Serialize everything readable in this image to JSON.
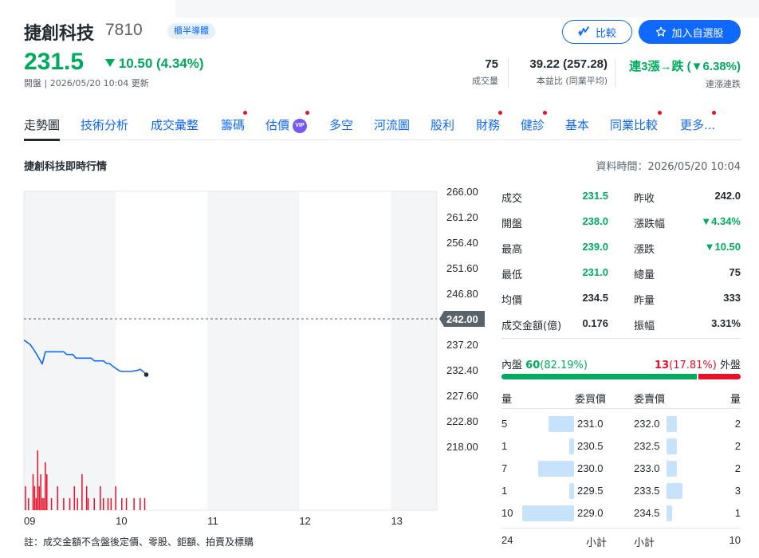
{
  "header": {
    "stock_name": "捷創科技",
    "stock_code": "7810",
    "market_badge": "櫃半導體",
    "compare_label": "比較",
    "watchlist_label": "加入自選股",
    "price": "231.5",
    "change": "10.50 (4.34%)",
    "updated": "開盤 | 2026/05/20 10:04 更新",
    "stats": [
      {
        "value": "75",
        "label": "成交量"
      },
      {
        "value": "39.22 (257.28)",
        "label": "本益比 (同業平均)"
      },
      {
        "value": "連3漲→跌 (▼6.38%)",
        "label": "連漲連跌"
      }
    ],
    "icons": {
      "compare": "compare-arrows-icon",
      "watch": "star-icon",
      "down": "triangle-down-icon"
    },
    "colors": {
      "down": "#00ab5e",
      "up": "#eb0f29",
      "brand": "#0f69ff"
    }
  },
  "tabs": [
    {
      "label": "走勢圖",
      "active": true,
      "dot": false
    },
    {
      "label": "技術分析",
      "active": false,
      "dot": false
    },
    {
      "label": "成交彙整",
      "active": false,
      "dot": false
    },
    {
      "label": "籌碼",
      "active": false,
      "dot": true
    },
    {
      "label": "估價",
      "active": false,
      "dot": true,
      "vip": "VIP"
    },
    {
      "label": "多空",
      "active": false,
      "dot": false
    },
    {
      "label": "河流圖",
      "active": false,
      "dot": false
    },
    {
      "label": "股利",
      "active": false,
      "dot": false
    },
    {
      "label": "財務",
      "active": false,
      "dot": true
    },
    {
      "label": "健診",
      "active": false,
      "dot": true
    },
    {
      "label": "基本",
      "active": false,
      "dot": false
    },
    {
      "label": "同業比較",
      "active": false,
      "dot": true
    },
    {
      "label": "更多...",
      "active": false,
      "dot": true
    }
  ],
  "section": {
    "title": "捷創科技即時行情",
    "data_time": "資料時間：2026/05/20 10:04"
  },
  "chart_data": {
    "type": "line",
    "x_ticks": [
      "09",
      "10",
      "11",
      "12",
      "13"
    ],
    "y_ticks": [
      "266.00",
      "261.20",
      "256.40",
      "251.60",
      "246.80",
      "237.20",
      "232.40",
      "227.60",
      "222.80",
      "218.00"
    ],
    "ylim": [
      218.0,
      266.0
    ],
    "reference_label": "242.00",
    "reference_value": 242.0,
    "x_range_minutes": [
      0,
      270
    ],
    "price_series": [
      [
        0,
        238.0
      ],
      [
        2,
        237.6
      ],
      [
        4,
        237.2
      ],
      [
        6,
        236.4
      ],
      [
        8,
        235.5
      ],
      [
        10,
        234.5
      ],
      [
        12,
        233.5
      ],
      [
        14,
        235.8
      ],
      [
        16,
        235.8
      ],
      [
        22,
        235.8
      ],
      [
        26,
        235.8
      ],
      [
        28,
        235.3
      ],
      [
        32,
        235.3
      ],
      [
        34,
        234.6
      ],
      [
        36,
        234.6
      ],
      [
        40,
        234.6
      ],
      [
        44,
        234.6
      ],
      [
        46,
        234.1
      ],
      [
        52,
        234.1
      ],
      [
        54,
        233.6
      ],
      [
        56,
        233.6
      ],
      [
        58,
        233.1
      ],
      [
        60,
        232.7
      ],
      [
        62,
        232.3
      ],
      [
        64,
        232.1
      ],
      [
        70,
        232.1
      ],
      [
        74,
        232.3
      ],
      [
        76,
        232.5
      ],
      [
        78,
        232.1
      ],
      [
        80,
        231.5
      ]
    ],
    "last_point": [
      80,
      231.5
    ],
    "volume_series": [
      [
        1,
        2
      ],
      [
        3,
        1
      ],
      [
        6,
        3
      ],
      [
        7,
        2
      ],
      [
        8,
        1
      ],
      [
        9,
        5
      ],
      [
        10,
        2
      ],
      [
        11,
        3
      ],
      [
        12,
        1
      ],
      [
        13,
        1
      ],
      [
        14,
        4
      ],
      [
        15,
        3
      ],
      [
        18,
        1
      ],
      [
        22,
        2
      ],
      [
        26,
        1
      ],
      [
        30,
        1
      ],
      [
        33,
        2
      ],
      [
        35,
        1
      ],
      [
        38,
        3
      ],
      [
        41,
        2
      ],
      [
        42,
        1
      ],
      [
        46,
        1
      ],
      [
        50,
        2
      ],
      [
        52,
        1
      ],
      [
        55,
        1
      ],
      [
        57,
        1
      ],
      [
        60,
        2
      ],
      [
        64,
        1
      ],
      [
        67,
        1
      ],
      [
        72,
        1
      ],
      [
        76,
        1
      ],
      [
        79,
        1
      ]
    ],
    "vol_max": 5,
    "colors": {
      "line": "#0f69ff",
      "volume": "#eb0f29",
      "ref": "#5b636a",
      "ref_tag": "#5b636a"
    }
  },
  "quote": {
    "left": [
      {
        "label": "成交",
        "value": "231.5",
        "color": "green"
      },
      {
        "label": "開盤",
        "value": "238.0",
        "color": "green"
      },
      {
        "label": "最高",
        "value": "239.0",
        "color": "green"
      },
      {
        "label": "最低",
        "value": "231.0",
        "color": "green"
      },
      {
        "label": "均價",
        "value": "234.5",
        "color": "dark"
      },
      {
        "label": "成交金額(億)",
        "value": "0.176",
        "color": "dark"
      }
    ],
    "right": [
      {
        "label": "昨收",
        "value": "242.0",
        "color": "dark"
      },
      {
        "label": "漲跌幅",
        "value": "▼4.34%",
        "color": "green"
      },
      {
        "label": "漲跌",
        "value": "▼10.50",
        "color": "green"
      },
      {
        "label": "總量",
        "value": "75",
        "color": "dark"
      },
      {
        "label": "昨量",
        "value": "333",
        "color": "dark"
      },
      {
        "label": "振幅",
        "value": "3.31%",
        "color": "dark"
      }
    ]
  },
  "pressure": {
    "inner_label": "內盤",
    "inner_value": "60",
    "inner_pct": "(82.19%)",
    "outer_value": "13",
    "outer_pct": "(17.81%)",
    "outer_label": "外盤",
    "inner_fraction": 0.8219
  },
  "orderbook": {
    "headers": {
      "bid_vol": "量",
      "bid_price": "委買價",
      "ask_price": "委賣價",
      "ask_vol": "量"
    },
    "bids": [
      {
        "vol": "5",
        "price": "231.0",
        "vol_num": 5
      },
      {
        "vol": "1",
        "price": "230.5",
        "vol_num": 1
      },
      {
        "vol": "7",
        "price": "230.0",
        "vol_num": 7
      },
      {
        "vol": "1",
        "price": "229.5",
        "vol_num": 1
      },
      {
        "vol": "10",
        "price": "229.0",
        "vol_num": 10
      }
    ],
    "asks": [
      {
        "price": "232.0",
        "vol": "2",
        "vol_num": 2
      },
      {
        "price": "232.5",
        "vol": "2",
        "vol_num": 2
      },
      {
        "price": "233.0",
        "vol": "2",
        "vol_num": 2
      },
      {
        "price": "233.5",
        "vol": "3",
        "vol_num": 3
      },
      {
        "price": "234.5",
        "vol": "1",
        "vol_num": 1
      }
    ],
    "max_vol": 10,
    "totals": {
      "bid_total": "24",
      "bid_label": "小計",
      "ask_label": "小計",
      "ask_total": "10"
    }
  },
  "footnote": "註：成交金額不含盤後定價、零股、鉅額、拍賣及標購"
}
